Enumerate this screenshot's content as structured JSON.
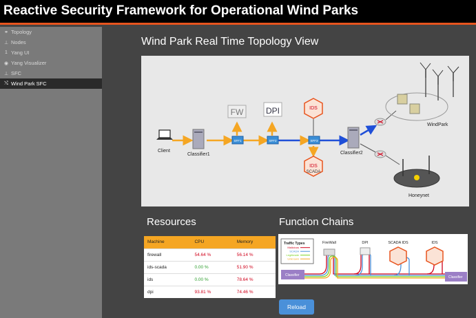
{
  "app": {
    "title": "Reactive Security Framework for Operational Wind Parks"
  },
  "sidebar": {
    "items": [
      {
        "label": "Topology",
        "icon": "topology-icon",
        "glyph": "⚭",
        "active": false
      },
      {
        "label": "Nodes",
        "icon": "sitemap-icon",
        "glyph": "⊥",
        "active": false
      },
      {
        "label": "Yang UI",
        "icon": "number-one-icon",
        "glyph": "1",
        "active": false
      },
      {
        "label": "Yang Visualizer",
        "icon": "eye-icon",
        "glyph": "◉",
        "active": false
      },
      {
        "label": "SFC",
        "icon": "sitemap-icon",
        "glyph": "⊥",
        "active": false
      },
      {
        "label": "Wind Park SFC",
        "icon": "shuffle-icon",
        "glyph": "⤭",
        "active": true
      }
    ]
  },
  "main": {
    "title": "Wind Park Real Time Topology View",
    "topology": {
      "labels": {
        "client": "Client",
        "classifier1": "Classifier1",
        "classifier2": "Classifier2",
        "sff1": "SFF1",
        "sff2": "SFF2",
        "sff3": "SFF3",
        "fw": "FW",
        "dpi": "DPI",
        "ids": "IDS",
        "ids_scada": "IDS",
        "scada": "SCADA",
        "windpark": "WindPark",
        "honeynet": "Honeynet"
      }
    },
    "resources": {
      "title": "Resources",
      "columns": [
        "Machine",
        "CPU",
        "Memory"
      ],
      "rows": [
        {
          "machine": "firewall",
          "cpu": "54.64 %",
          "memory": "56.14 %",
          "cpu_status": "red"
        },
        {
          "machine": "ids-scada",
          "cpu": "0.00 %",
          "memory": "51.90 %",
          "cpu_status": "green"
        },
        {
          "machine": "ids",
          "cpu": "0.00 %",
          "memory": "78.64 %",
          "cpu_status": "green"
        },
        {
          "machine": "dpi",
          "cpu": "93.81 %",
          "memory": "74.46 %",
          "cpu_status": "red"
        }
      ]
    },
    "function_chains": {
      "title": "Function Chains",
      "traffic_types_title": "Traffic Types",
      "traffic_types": [
        {
          "label": "Malicious",
          "color": "#d0021b"
        },
        {
          "label": "SCADA",
          "color": "#4a90d9"
        },
        {
          "label": "Legitimate",
          "color": "#7ed321"
        },
        {
          "label": "Unknown",
          "color": "#f5a623"
        }
      ],
      "columns": [
        "FireWall",
        "DPI",
        "SCADA IDS",
        "IDS"
      ],
      "classifier_label": "Classifier"
    },
    "reload_label": "Reload"
  },
  "colors": {
    "accent": "#e8541e",
    "sidebar_bg": "#7a7a7a",
    "main_bg": "#444444",
    "table_header": "#f5a623",
    "reload": "#4a90d9"
  }
}
